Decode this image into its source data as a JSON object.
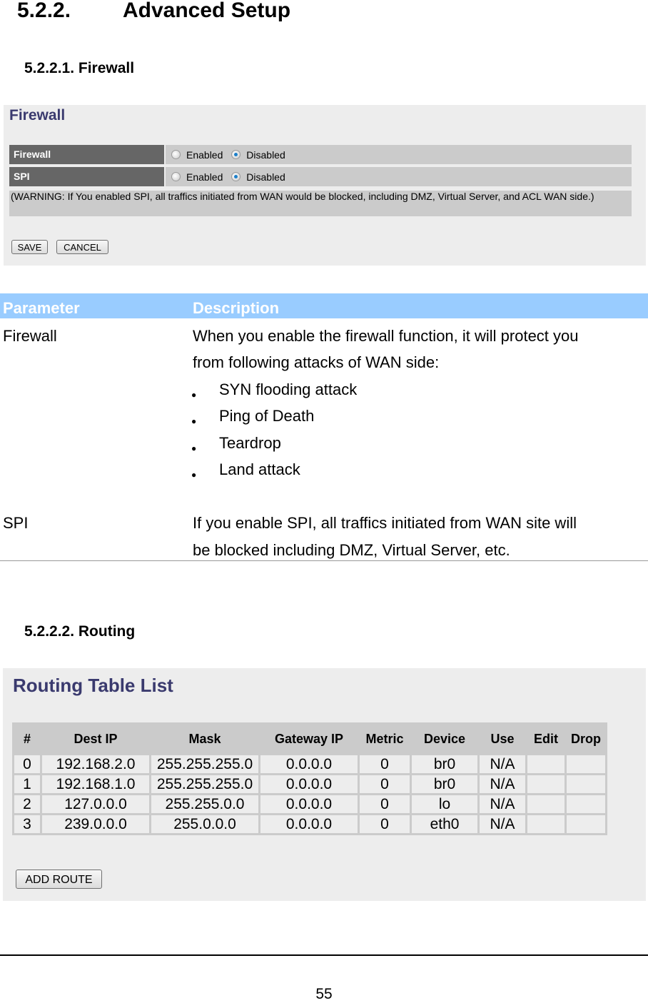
{
  "headings": {
    "section": {
      "number": "5.2.2.",
      "title": "Advanced Setup"
    },
    "firewall": "5.2.2.1. Firewall",
    "routing": "5.2.2.2. Routing"
  },
  "firewall_panel": {
    "title": "Firewall",
    "rows": [
      {
        "label": "Firewall",
        "options": [
          "Enabled",
          "Disabled"
        ],
        "selected": "Disabled"
      },
      {
        "label": "SPI",
        "options": [
          "Enabled",
          "Disabled"
        ],
        "selected": "Disabled"
      }
    ],
    "warning": "(WARNING: If You enabled SPI, all traffics initiated from WAN would be blocked, including DMZ, Virtual Server, and ACL WAN side.)",
    "save_label": "SAVE",
    "cancel_label": "CANCEL"
  },
  "param_table": {
    "headers": [
      "Parameter",
      "Description"
    ],
    "rows": [
      {
        "parameter": "Firewall",
        "description_lines": [
          "When you enable the firewall function, it will protect you",
          "from following attacks of WAN side:"
        ],
        "bullets": [
          "SYN flooding attack",
          "Ping of Death",
          "Teardrop",
          "Land attack"
        ]
      },
      {
        "parameter": "SPI",
        "description_lines": [
          "If you enable SPI, all traffics initiated from WAN site will",
          "be blocked including DMZ, Virtual Server, etc."
        ]
      }
    ]
  },
  "routing_panel": {
    "title": "Routing Table List",
    "columns": [
      "#",
      "Dest IP",
      "Mask",
      "Gateway IP",
      "Metric",
      "Device",
      "Use",
      "Edit",
      "Drop"
    ],
    "rows": [
      [
        "0",
        "192.168.2.0",
        "255.255.255.0",
        "0.0.0.0",
        "0",
        "br0",
        "N/A",
        "",
        ""
      ],
      [
        "1",
        "192.168.1.0",
        "255.255.255.0",
        "0.0.0.0",
        "0",
        "br0",
        "N/A",
        "",
        ""
      ],
      [
        "2",
        "127.0.0.0",
        "255.255.0.0",
        "0.0.0.0",
        "0",
        "lo",
        "N/A",
        "",
        ""
      ],
      [
        "3",
        "239.0.0.0",
        "255.0.0.0",
        "0.0.0.0",
        "0",
        "eth0",
        "N/A",
        "",
        ""
      ]
    ],
    "add_route_label": "ADD ROUTE"
  },
  "footer": {
    "page_number": "55"
  },
  "colors": {
    "table_header": "#99ccff",
    "panel_title": "#3a3a6e",
    "label_bg": "#666666"
  }
}
